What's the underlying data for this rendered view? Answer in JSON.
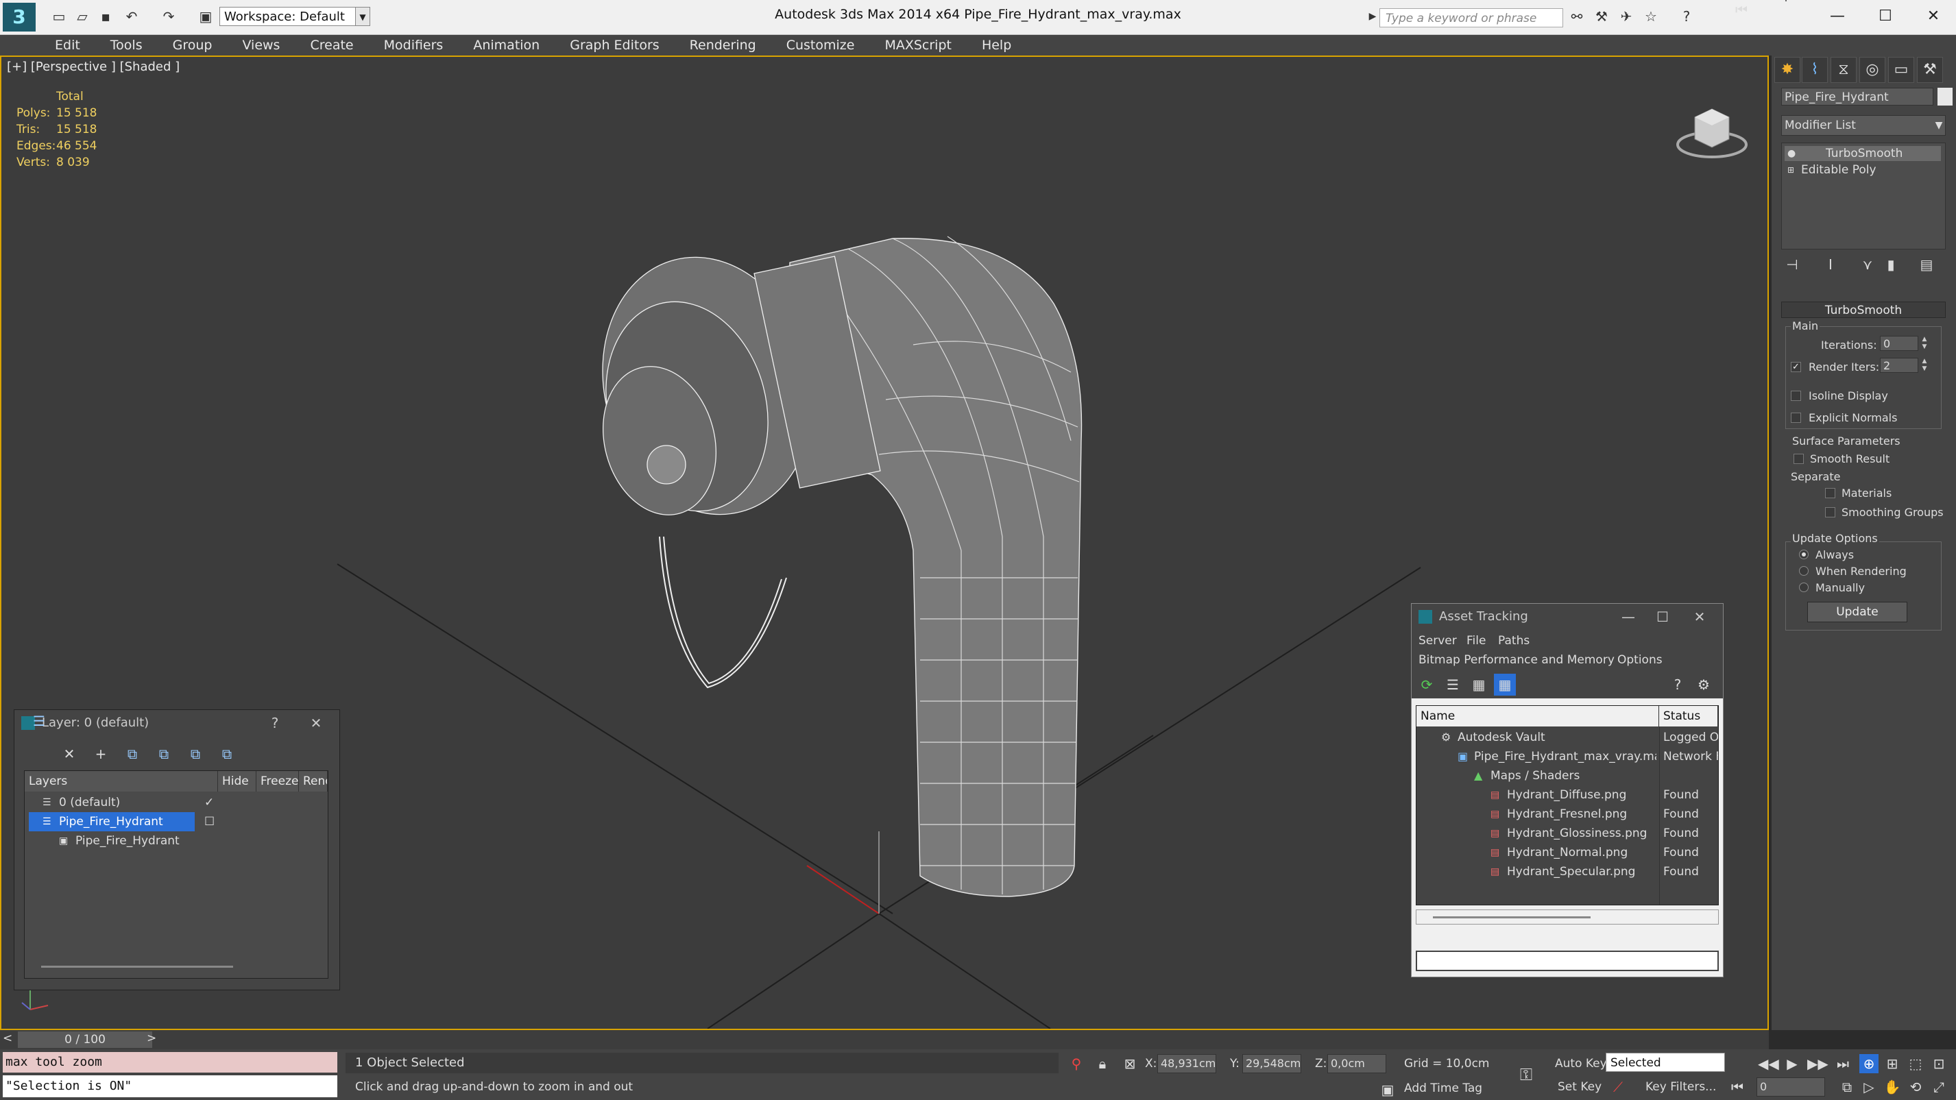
{
  "app": {
    "title": "Autodesk 3ds Max  2014 x64     Pipe_Fire_Hydrant_max_vray.max",
    "workspace": "Workspace: Default",
    "search_placeholder": "Type a keyword or phrase"
  },
  "menu": [
    "Edit",
    "Tools",
    "Group",
    "Views",
    "Create",
    "Modifiers",
    "Animation",
    "Graph Editors",
    "Rendering",
    "Customize",
    "MAXScript",
    "Help"
  ],
  "viewport": {
    "label": "[+] [Perspective ] [Shaded ]",
    "stats": {
      "header": "Total",
      "rows": [
        {
          "label": "Polys:",
          "value": "15 518"
        },
        {
          "label": "Tris:",
          "value": "15 518"
        },
        {
          "label": "Edges:",
          "value": "46 554"
        },
        {
          "label": "Verts:",
          "value": "8 039"
        }
      ]
    }
  },
  "command_panel": {
    "object_name": "Pipe_Fire_Hydrant",
    "modifier_list": "Modifier List",
    "stack": [
      "TurboSmooth",
      "Editable Poly"
    ],
    "rollout_title": "TurboSmooth",
    "main_group": "Main",
    "iterations_label": "Iterations:",
    "iterations_value": "0",
    "render_iters_label": "Render Iters:",
    "render_iters_value": "2",
    "isoline_display": "Isoline Display",
    "explicit_normals": "Explicit Normals",
    "surface_params": "Surface Parameters",
    "smooth_result": "Smooth Result",
    "separate": "Separate",
    "materials": "Materials",
    "smoothing_groups": "Smoothing Groups",
    "update_options": "Update Options",
    "always": "Always",
    "when_rendering": "When Rendering",
    "manually": "Manually",
    "update_button": "Update"
  },
  "layer_dialog": {
    "title": "Layer: 0 (default)",
    "help": "?",
    "columns": [
      "Layers",
      "Hide",
      "Freeze",
      "Rend"
    ],
    "rows": [
      "0 (default)",
      "Pipe_Fire_Hydrant",
      "Pipe_Fire_Hydrant"
    ]
  },
  "asset_tracking": {
    "title": "Asset Tracking",
    "menu1": [
      "Server",
      "File",
      "Paths"
    ],
    "menu2": [
      "Bitmap Performance and Memory",
      "Options"
    ],
    "columns": [
      "Name",
      "Status"
    ],
    "rows": [
      {
        "name": "Autodesk Vault",
        "status": "Logged O"
      },
      {
        "name": "Pipe_Fire_Hydrant_max_vray.max",
        "status": "Network F"
      },
      {
        "name": "Maps / Shaders",
        "status": ""
      },
      {
        "name": "Hydrant_Diffuse.png",
        "status": "Found"
      },
      {
        "name": "Hydrant_Fresnel.png",
        "status": "Found"
      },
      {
        "name": "Hydrant_Glossiness.png",
        "status": "Found"
      },
      {
        "name": "Hydrant_Normal.png",
        "status": "Found"
      },
      {
        "name": "Hydrant_Specular.png",
        "status": "Found"
      }
    ]
  },
  "status": {
    "time_slider": "0 / 100",
    "maxscript_line1": "max tool zoom",
    "maxscript_line2": "\"Selection is ON\"",
    "selection": "1 Object Selected",
    "prompt": "Click and drag up-and-down to zoom in and out",
    "x_label": "X:",
    "x_value": "48,931cm",
    "y_label": "Y:",
    "y_value": "29,548cm",
    "z_label": "Z:",
    "z_value": "0,0cm",
    "grid": "Grid = 10,0cm",
    "add_time_tag": "Add Time Tag",
    "auto_key": "Auto Key",
    "set_key": "Set Key",
    "selected_dropdown": "Selected",
    "key_filters": "Key Filters...",
    "frame": "0"
  },
  "colors": {
    "accent": "#d9a300",
    "stats": "#f0d060",
    "selection_row": "#2a6fd6",
    "viewport_bg": "#3c3c3c"
  }
}
